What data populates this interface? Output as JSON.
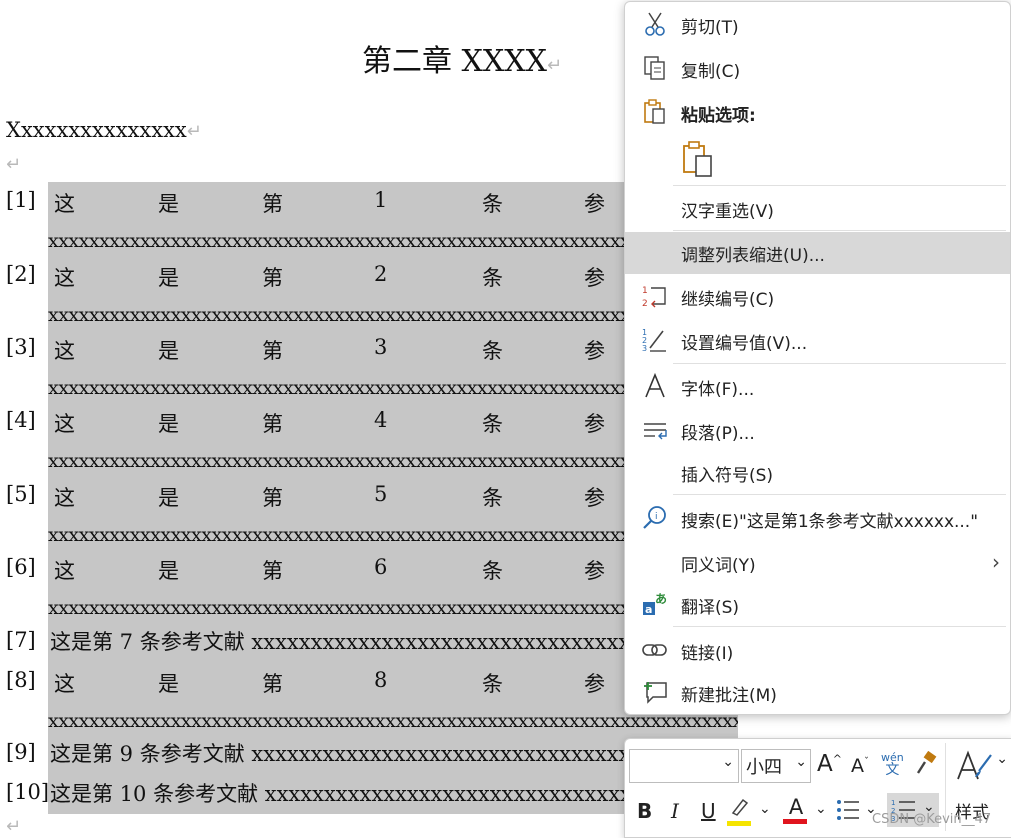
{
  "document": {
    "title": "第二章 XXXX",
    "body_text": "Xxxxxxxxxxxxxxx",
    "paragraph_mark": "↵",
    "references": [
      {
        "num": "[1]",
        "words": [
          "这",
          "是",
          "第",
          "1",
          "条",
          "参"
        ]
      },
      {
        "num": "[2]",
        "words": [
          "这",
          "是",
          "第",
          "2",
          "条",
          "参"
        ]
      },
      {
        "num": "[3]",
        "words": [
          "这",
          "是",
          "第",
          "3",
          "条",
          "参"
        ]
      },
      {
        "num": "[4]",
        "words": [
          "这",
          "是",
          "第",
          "4",
          "条",
          "参"
        ]
      },
      {
        "num": "[5]",
        "words": [
          "这",
          "是",
          "第",
          "5",
          "条",
          "参"
        ]
      },
      {
        "num": "[6]",
        "words": [
          "这",
          "是",
          "第",
          "6",
          "条",
          "参"
        ]
      },
      {
        "num": "[7]",
        "text": "这是第 7 条参考文献 xxxxxxxxxxxxxxxxxxxxxxxxxxxxxxxxxx"
      },
      {
        "num": "[8]",
        "words": [
          "这",
          "是",
          "第",
          "8",
          "条",
          "参"
        ]
      },
      {
        "num": "[9]",
        "text": "这是第 9 条参考文献 xxxxxxxxxxxxxxxxxxxxxxxxxxxxxxxxx"
      },
      {
        "num": "[10]",
        "text": "这是第 10 条参考文献 xxxxxxxxxxxxxxxxxxxxxxxxxxxxxxxx"
      }
    ],
    "continuation": "xxxxxxxxxxxxxxxxxxxxxxxxxxxxxxxxxxxxxxxxxxxxxxxxxxxxxxxxxxxxxxxxxxxxxxxxxxxxxxxxxxx"
  },
  "context_menu": {
    "cut": "剪切(T)",
    "copy": "复制(C)",
    "paste_options": "粘贴选项:",
    "reconvert": "汉字重选(V)",
    "adjust_list_indent": "调整列表缩进(U)...",
    "continue_numbering": "继续编号(C)",
    "set_numbering_value": "设置编号值(V)...",
    "font": "字体(F)...",
    "paragraph": "段落(P)...",
    "insert_symbol": "插入符号(S)",
    "search": "搜索(E)\"这是第1条参考文献xxxxxx...\"",
    "synonyms": "同义词(Y)",
    "translate": "翻译(S)",
    "link": "链接(I)",
    "new_comment": "新建批注(M)",
    "submenu_arrow": "›",
    "icons": [
      "scissors-icon",
      "copy-icon",
      "paste-icon",
      "paste-keep-text-icon",
      "continue-numbering-icon",
      "set-numbering-value-icon",
      "font-icon",
      "paragraph-icon",
      "search-icon",
      "translate-icon",
      "link-icon",
      "new-comment-icon"
    ]
  },
  "mini_toolbar": {
    "font_name": "",
    "font_size": "小四",
    "grow_font": "A",
    "shrink_font": "A",
    "phonetic_top": "wén",
    "phonetic_bottom": "文",
    "bold": "B",
    "italic": "I",
    "underline": "U",
    "font_color_letter": "A",
    "styles": "样式",
    "highlight_color": "#f5e400",
    "font_color": "#e0141e"
  },
  "watermark": "CSDN @Kevin__47"
}
